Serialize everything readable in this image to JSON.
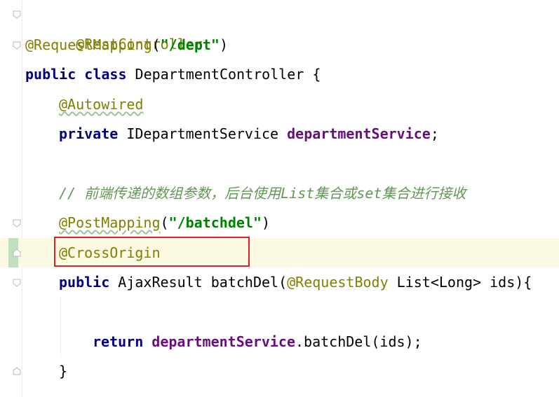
{
  "editor": {
    "language": "Java",
    "lines": [
      {
        "tokens": [
          {
            "t": "@RestController",
            "c": "ann"
          }
        ]
      },
      {
        "tokens": [
          {
            "t": "@RequestMapping",
            "c": "ann"
          },
          {
            "t": "(",
            "c": "plain"
          },
          {
            "t": "\"/dept\"",
            "c": "str"
          },
          {
            "t": ")",
            "c": "plain"
          }
        ]
      },
      {
        "tokens": [
          {
            "t": "public",
            "c": "kw"
          },
          {
            "t": " ",
            "c": "plain"
          },
          {
            "t": "class",
            "c": "kw"
          },
          {
            "t": " DepartmentController {",
            "c": "plain"
          }
        ]
      },
      {
        "tokens": [
          {
            "t": "@Autowired",
            "c": "ann"
          }
        ]
      },
      {
        "tokens": [
          {
            "t": "private",
            "c": "kw"
          },
          {
            "t": " IDepartmentService ",
            "c": "plain"
          },
          {
            "t": "departmentService",
            "c": "field"
          },
          {
            "t": ";",
            "c": "plain"
          }
        ]
      },
      {
        "tokens": []
      },
      {
        "tokens": [
          {
            "t": "// 前端传递的数组参数，后台使用List集合或set集合进行接收",
            "c": "comment"
          }
        ]
      },
      {
        "tokens": [
          {
            "t": "@PostMapping",
            "c": "ann"
          },
          {
            "t": "(",
            "c": "plain"
          },
          {
            "t": "\"/batchdel\"",
            "c": "str"
          },
          {
            "t": ")",
            "c": "plain"
          }
        ]
      },
      {
        "tokens": [
          {
            "t": "@CrossOrigin",
            "c": "ann"
          }
        ]
      },
      {
        "tokens": [
          {
            "t": "public",
            "c": "kw"
          },
          {
            "t": " AjaxResult batchDel(",
            "c": "plain"
          },
          {
            "t": "@RequestBody",
            "c": "ann"
          },
          {
            "t": " List<Long> ids){",
            "c": "plain"
          }
        ]
      },
      {
        "tokens": []
      },
      {
        "tokens": [
          {
            "t": "return",
            "c": "kw"
          },
          {
            "t": " ",
            "c": "plain"
          },
          {
            "t": "departmentService",
            "c": "field"
          },
          {
            "t": ".batchDel(ids);",
            "c": "plain"
          }
        ]
      },
      {
        "tokens": [
          {
            "t": "}",
            "c": "plain"
          }
        ]
      }
    ],
    "highlighted_line_text": "@CrossOrigin",
    "colors": {
      "keyword": "#000080",
      "annotation": "#808000",
      "string": "#008000",
      "field": "#660e7a",
      "comment": "#629755",
      "current_line_bg": "#fdfae3",
      "highlight_box": "#e02020"
    },
    "gutter_icons": [
      "fold-open-icon",
      "fold-open-icon",
      "fold-open-icon",
      "fold-open-icon",
      "fold-open-icon",
      "fold-close-icon"
    ]
  }
}
